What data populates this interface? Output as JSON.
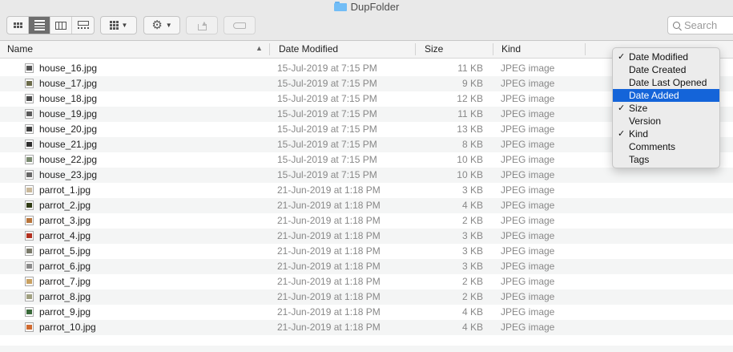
{
  "window": {
    "title": "DupFolder"
  },
  "toolbar": {
    "view_buttons": [
      "icon-view-icon",
      "list-view-icon",
      "column-view-icon",
      "gallery-view-icon"
    ],
    "active_view": 1,
    "search_placeholder": "Search"
  },
  "columns": {
    "name": "Name",
    "date_modified": "Date Modified",
    "size": "Size",
    "kind": "Kind"
  },
  "files": [
    {
      "name": "house_16.jpg",
      "date": "15-Jul-2019 at 7:15 PM",
      "size": "11 KB",
      "kind": "JPEG image",
      "thumb_color": "#555555"
    },
    {
      "name": "house_17.jpg",
      "date": "15-Jul-2019 at 7:15 PM",
      "size": "9 KB",
      "kind": "JPEG image",
      "thumb_color": "#6b6b4a"
    },
    {
      "name": "house_18.jpg",
      "date": "15-Jul-2019 at 7:15 PM",
      "size": "12 KB",
      "kind": "JPEG image",
      "thumb_color": "#4a4a4a"
    },
    {
      "name": "house_19.jpg",
      "date": "15-Jul-2019 at 7:15 PM",
      "size": "11 KB",
      "kind": "JPEG image",
      "thumb_color": "#5a5a5a"
    },
    {
      "name": "house_20.jpg",
      "date": "15-Jul-2019 at 7:15 PM",
      "size": "13 KB",
      "kind": "JPEG image",
      "thumb_color": "#3e3e3e"
    },
    {
      "name": "house_21.jpg",
      "date": "15-Jul-2019 at 7:15 PM",
      "size": "8 KB",
      "kind": "JPEG image",
      "thumb_color": "#2e2e2e"
    },
    {
      "name": "house_22.jpg",
      "date": "15-Jul-2019 at 7:15 PM",
      "size": "10 KB",
      "kind": "JPEG image",
      "thumb_color": "#7a8a70"
    },
    {
      "name": "house_23.jpg",
      "date": "15-Jul-2019 at 7:15 PM",
      "size": "10 KB",
      "kind": "JPEG image",
      "thumb_color": "#666666"
    },
    {
      "name": "parrot_1.jpg",
      "date": "21-Jun-2019 at 1:18 PM",
      "size": "3 KB",
      "kind": "JPEG image",
      "thumb_color": "#c9b89a"
    },
    {
      "name": "parrot_2.jpg",
      "date": "21-Jun-2019 at 1:18 PM",
      "size": "4 KB",
      "kind": "JPEG image",
      "thumb_color": "#2f3a14"
    },
    {
      "name": "parrot_3.jpg",
      "date": "21-Jun-2019 at 1:18 PM",
      "size": "2 KB",
      "kind": "JPEG image",
      "thumb_color": "#b8743a"
    },
    {
      "name": "parrot_4.jpg",
      "date": "21-Jun-2019 at 1:18 PM",
      "size": "3 KB",
      "kind": "JPEG image",
      "thumb_color": "#b2301f"
    },
    {
      "name": "parrot_5.jpg",
      "date": "21-Jun-2019 at 1:18 PM",
      "size": "3 KB",
      "kind": "JPEG image",
      "thumb_color": "#7a7a6a"
    },
    {
      "name": "parrot_6.jpg",
      "date": "21-Jun-2019 at 1:18 PM",
      "size": "3 KB",
      "kind": "JPEG image",
      "thumb_color": "#8a8a8a"
    },
    {
      "name": "parrot_7.jpg",
      "date": "21-Jun-2019 at 1:18 PM",
      "size": "2 KB",
      "kind": "JPEG image",
      "thumb_color": "#c8a060"
    },
    {
      "name": "parrot_8.jpg",
      "date": "21-Jun-2019 at 1:18 PM",
      "size": "2 KB",
      "kind": "JPEG image",
      "thumb_color": "#a0a080"
    },
    {
      "name": "parrot_9.jpg",
      "date": "21-Jun-2019 at 1:18 PM",
      "size": "4 KB",
      "kind": "JPEG image",
      "thumb_color": "#3a6a3a"
    },
    {
      "name": "parrot_10.jpg",
      "date": "21-Jun-2019 at 1:18 PM",
      "size": "4 KB",
      "kind": "JPEG image",
      "thumb_color": "#d06a30"
    }
  ],
  "column_menu": {
    "items": [
      {
        "label": "Date Modified",
        "checked": true,
        "highlighted": false
      },
      {
        "label": "Date Created",
        "checked": false,
        "highlighted": false
      },
      {
        "label": "Date Last Opened",
        "checked": false,
        "highlighted": false
      },
      {
        "label": "Date Added",
        "checked": false,
        "highlighted": true
      },
      {
        "label": "Size",
        "checked": true,
        "highlighted": false
      },
      {
        "label": "Version",
        "checked": false,
        "highlighted": false
      },
      {
        "label": "Kind",
        "checked": true,
        "highlighted": false
      },
      {
        "label": "Comments",
        "checked": false,
        "highlighted": false
      },
      {
        "label": "Tags",
        "checked": false,
        "highlighted": false
      }
    ],
    "check_glyph": "✓",
    "highlight_color": "#1464d9"
  }
}
